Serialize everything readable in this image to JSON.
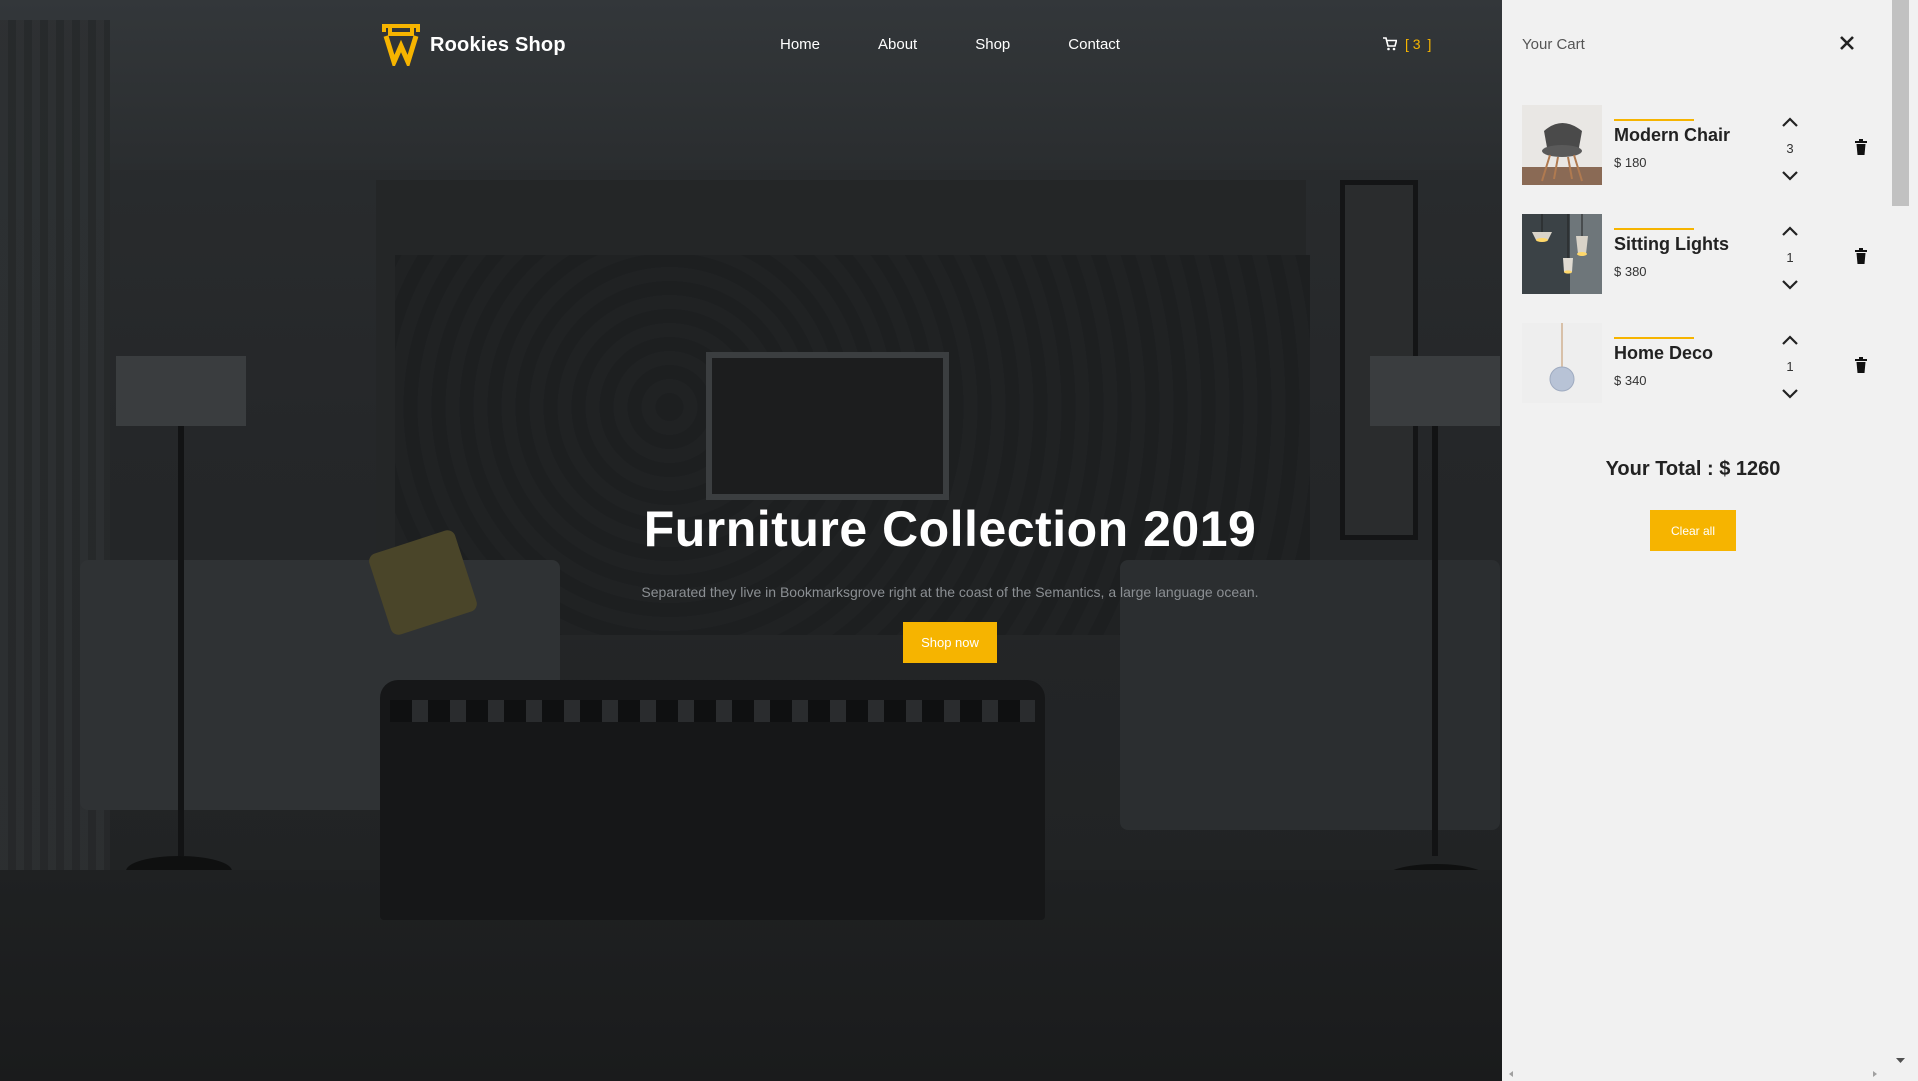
{
  "brand": {
    "name": "Rookies Shop",
    "logo_icon": "w-logo-icon"
  },
  "nav": {
    "items": [
      {
        "label": "Home"
      },
      {
        "label": "About"
      },
      {
        "label": "Shop"
      },
      {
        "label": "Contact"
      }
    ]
  },
  "cart_link": {
    "icon": "cart-icon",
    "count": "3",
    "open_bracket": "[",
    "close_bracket": "]"
  },
  "hero": {
    "title": "Furniture Collection 2019",
    "subtitle": "Separated they live in Bookmarksgrove right at the coast of the Semantics, a large language ocean.",
    "cta": "Shop now"
  },
  "cart_panel": {
    "title": "Your Cart",
    "close_icon": "close-icon",
    "items": [
      {
        "name": "Modern Chair",
        "price": "$ 180",
        "qty": "3",
        "thumb": "chair-thumbnail"
      },
      {
        "name": "Sitting Lights",
        "price": "$ 380",
        "qty": "1",
        "thumb": "pendant-lights-thumbnail"
      },
      {
        "name": "Home Deco",
        "price": "$ 340",
        "qty": "1",
        "thumb": "home-deco-thumbnail"
      }
    ],
    "total": "Your Total : $ 1260",
    "clear_label": "Clear all"
  },
  "colors": {
    "accent": "#f6b400",
    "hero_overlay": "#232526",
    "panel_bg": "#f1f1f1",
    "text_dark": "#222222",
    "text_muted": "#8b8f93"
  }
}
